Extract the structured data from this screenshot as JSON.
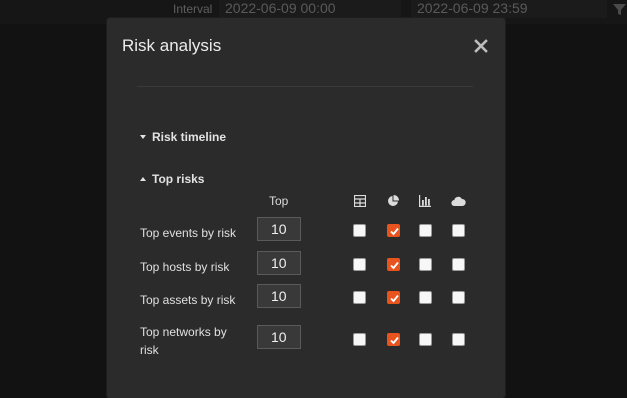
{
  "background": {
    "interval_label": "Interval",
    "start": "2022-06-09 00:00",
    "end": "2022-06-09 23:59"
  },
  "modal": {
    "title": "Risk analysis",
    "sections": {
      "timeline": "Risk timeline",
      "top_risks": "Top risks"
    },
    "columns": {
      "top": "Top",
      "icons": [
        "table-icon",
        "pie-chart-icon",
        "bar-chart-icon",
        "cloud-icon"
      ]
    },
    "rows": [
      {
        "label": "Top events by risk",
        "value": "10",
        "checks": [
          false,
          true,
          false,
          false
        ]
      },
      {
        "label": "Top hosts by risk",
        "value": "10",
        "checks": [
          false,
          true,
          false,
          false
        ]
      },
      {
        "label": "Top assets by risk",
        "value": "10",
        "checks": [
          false,
          true,
          false,
          false
        ]
      },
      {
        "label": "Top networks by risk",
        "value": "10",
        "checks": [
          false,
          true,
          false,
          false
        ]
      }
    ]
  },
  "colors": {
    "accent": "#e8541e",
    "modal_bg": "#2b2b2b",
    "page_bg": "#121212"
  }
}
